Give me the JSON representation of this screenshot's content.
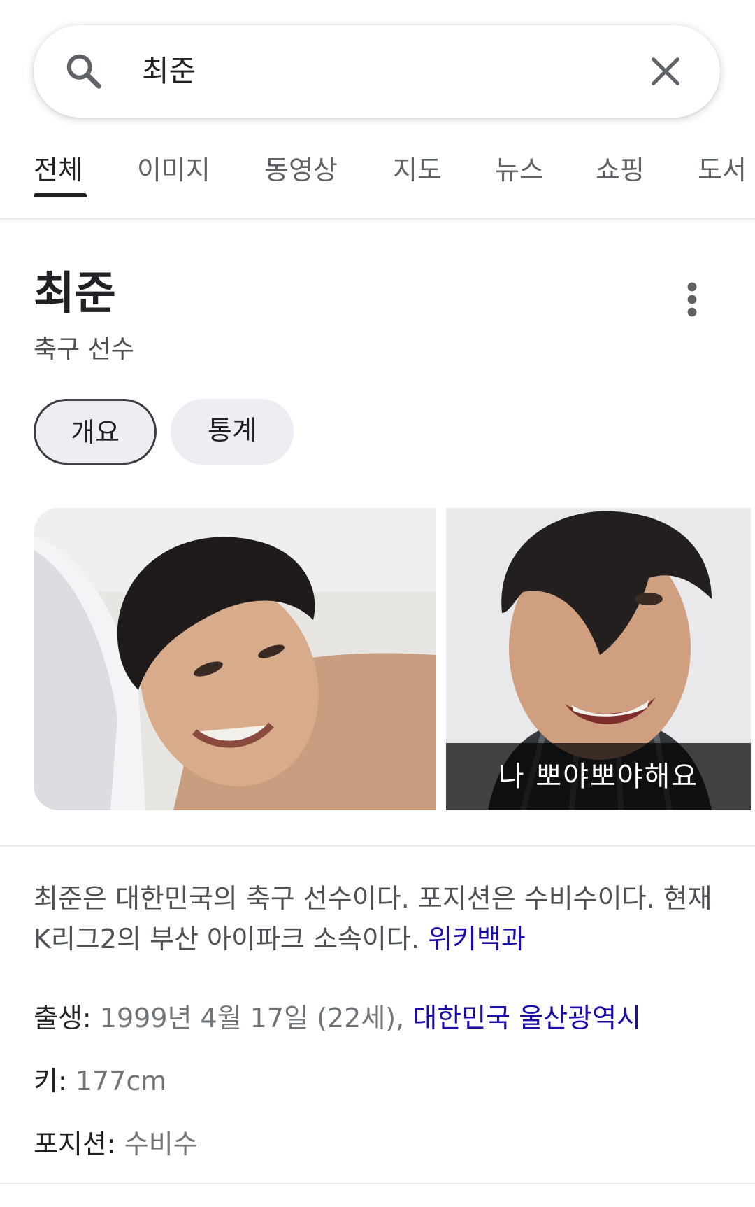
{
  "search": {
    "query": "최준"
  },
  "tabs": [
    "전체",
    "이미지",
    "동영상",
    "지도",
    "뉴스",
    "쇼핑",
    "도서"
  ],
  "entity": {
    "title": "최준",
    "subtitle": "축구 선수",
    "chips": [
      "개요",
      "통계"
    ]
  },
  "images": {
    "caption": "나 뽀야뽀야해요"
  },
  "description": {
    "text": "최준은 대한민국의 축구 선수이다. 포지션은 수비수이다. 현재 K리그2의 부산 아이파크 소속이다. ",
    "source": "위키백과"
  },
  "facts": {
    "birth": {
      "label": "출생",
      "value": "1999년 4월 17일 (22세), ",
      "link": "대한민국 울산광역시"
    },
    "height": {
      "label": "키",
      "value": "177cm"
    },
    "position": {
      "label": "포지션",
      "value": "수비수"
    }
  },
  "colors": {
    "link": "#1a0dab",
    "accent_text": "#202124",
    "muted": "#70757a"
  }
}
